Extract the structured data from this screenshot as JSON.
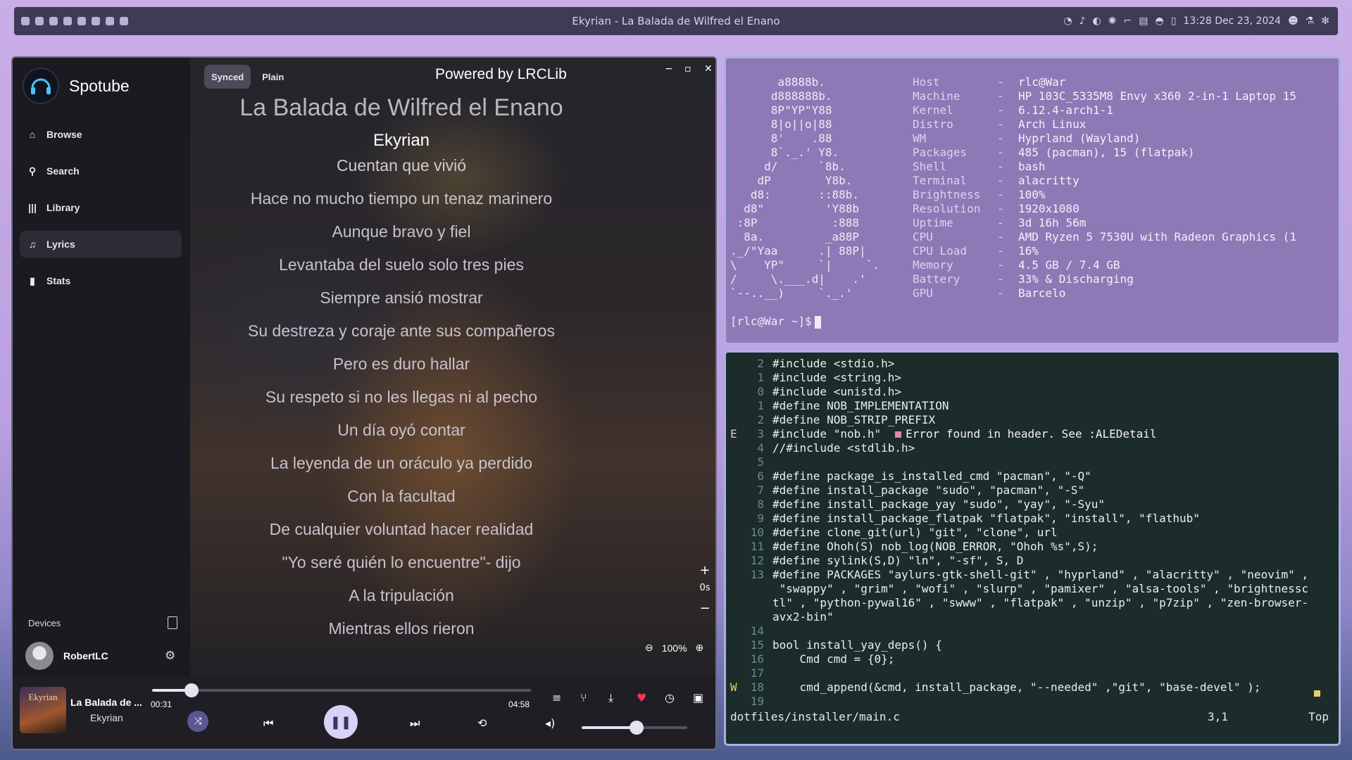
{
  "topbar": {
    "title": "Ekyrian - La Balada de Wilfred el Enano",
    "datetime": "13:28 Dec 23, 2024",
    "left_icons": [
      "app-icon-1",
      "app-icon-2",
      "app-icon-3",
      "app-icon-4",
      "app-icon-5",
      "app-icon-6",
      "app-icon-7",
      "app-icon-8"
    ],
    "right_icons": [
      "wifi-icon",
      "volume-icon",
      "moon-icon",
      "brightness-icon",
      "arrow-icon",
      "keyboard-icon",
      "headphones-icon",
      "clipboard-icon",
      "discord-icon",
      "flask-icon",
      "gear-icon"
    ]
  },
  "spotube": {
    "app_name": "Spotube",
    "nav": [
      {
        "label": "Browse",
        "icon": "home-icon"
      },
      {
        "label": "Search",
        "icon": "search-icon"
      },
      {
        "label": "Library",
        "icon": "library-icon"
      },
      {
        "label": "Lyrics",
        "icon": "music-note-icon",
        "active": true
      },
      {
        "label": "Stats",
        "icon": "bar-chart-icon"
      }
    ],
    "devices_label": "Devices",
    "username": "RobertLC",
    "tabs": {
      "synced": "Synced",
      "plain": "Plain"
    },
    "powered_by": "Powered by LRCLib",
    "song_title": "La Balada de Wilfred el Enano",
    "artist": "Ekyrian",
    "lyrics": [
      "Cuentan que vivió",
      "Hace no mucho tiempo un tenaz marinero",
      "Aunque bravo y fiel",
      "Levantaba del suelo solo tres pies",
      "Siempre ansió mostrar",
      "Su destreza y coraje ante sus compañeros",
      "Pero es duro hallar",
      "Su respeto si no les llegas ni al pecho",
      "Un día oyó contar",
      "La leyenda de un oráculo ya perdido",
      "Con la facultad",
      "De cualquier voluntad hacer realidad",
      "\"Yo seré quién lo encuentre\"- dijo",
      "A la tripulación",
      "Mientras ellos rieron"
    ],
    "time_offset": {
      "plus": "+",
      "value": "0s",
      "minus": "−"
    },
    "zoom": "100%",
    "player": {
      "track_name": "La Balada de ...",
      "track_artist": "Ekyrian",
      "album_text": "Ekyrian",
      "elapsed": "00:31",
      "duration": "04:58",
      "progress": 0.104,
      "volume": 0.52
    }
  },
  "terminal": {
    "ascii": "       a8888b.\n      d888888b.\n      8P\"YP\"Y88\n      8|o||o|88\n      8'    .88\n      8`._.' Y8.\n     d/      `8b.\n    dP        Y8b.\n   d8:       ::88b.\n  d8\"         'Y88b\n :8P           :888\n  8a.         _a88P\n._/\"Yaa      .| 88P|\n\\    YP\"     `|     `.\n/     \\.___.d|    .'\n`--..__)     `._.'",
    "rows": [
      {
        "key": "Host",
        "value": "rlc@War"
      },
      {
        "key": "Machine",
        "value": "HP 103C_5335M8 Envy x360 2-in-1 Laptop 15"
      },
      {
        "key": "Kernel",
        "value": "6.12.4-arch1-1"
      },
      {
        "key": "Distro",
        "value": "Arch Linux"
      },
      {
        "key": "WM",
        "value": "Hyprland (Wayland)"
      },
      {
        "key": "Packages",
        "value": "485 (pacman), 15 (flatpak)"
      },
      {
        "key": "Shell",
        "value": "bash"
      },
      {
        "key": "Terminal",
        "value": "alacritty"
      },
      {
        "key": "Brightness",
        "value": "100%"
      },
      {
        "key": "Resolution",
        "value": "1920x1080"
      },
      {
        "key": "Uptime",
        "value": "3d 16h 56m"
      },
      {
        "key": "CPU",
        "value": "AMD Ryzen 5 7530U with Radeon Graphics (1"
      },
      {
        "key": "CPU Load",
        "value": "16%"
      },
      {
        "key": "Memory",
        "value": "4.5 GB / 7.4 GB"
      },
      {
        "key": "Battery",
        "value": "33% & Discharging"
      },
      {
        "key": "GPU",
        "value": "Barcelo"
      }
    ],
    "separator": "-",
    "prompt": "[rlc@War ~]$"
  },
  "editor": {
    "lines": [
      {
        "sign": "",
        "num": "2",
        "text": "#include <stdio.h>"
      },
      {
        "sign": "",
        "num": "1",
        "text": "#include <string.h>"
      },
      {
        "sign": "",
        "num": "0",
        "text": "#include <unistd.h>"
      },
      {
        "sign": "",
        "num": "1",
        "text": "#define NOB_IMPLEMENTATION"
      },
      {
        "sign": "",
        "num": "2",
        "text": "#define NOB_STRIP_PREFIX"
      },
      {
        "sign": "E",
        "num": "3",
        "text": "#include \"nob.h\"",
        "error": "Error found in header. See :ALEDetail"
      },
      {
        "sign": "",
        "num": "4",
        "text": "//#include <stdlib.h>"
      },
      {
        "sign": "",
        "num": "5",
        "text": ""
      },
      {
        "sign": "",
        "num": "6",
        "text": "#define package_is_installed_cmd \"pacman\", \"-Q\""
      },
      {
        "sign": "",
        "num": "7",
        "text": "#define install_package \"sudo\", \"pacman\", \"-S\""
      },
      {
        "sign": "",
        "num": "8",
        "text": "#define install_package_yay \"sudo\", \"yay\", \"-Syu\""
      },
      {
        "sign": "",
        "num": "9",
        "text": "#define install_package_flatpak \"flatpak\", \"install\", \"flathub\""
      },
      {
        "sign": "",
        "num": "10",
        "text": "#define clone_git(url) \"git\", \"clone\", url"
      },
      {
        "sign": "",
        "num": "11",
        "text": "#define Ohoh(S) nob_log(NOB_ERROR, \"Ohoh %s\",S);"
      },
      {
        "sign": "",
        "num": "12",
        "text": "#define sylink(S,D) \"ln\", \"-sf\", S, D"
      },
      {
        "sign": "",
        "num": "13",
        "text": "#define PACKAGES \"aylurs-gtk-shell-git\" , \"hyprland\" , \"alacritty\" , \"neovim\" ,"
      },
      {
        "sign": "",
        "num": "",
        "text": " \"swappy\" , \"grim\" , \"wofi\" , \"slurp\" , \"pamixer\" , \"alsa-tools\" , \"brightnessc"
      },
      {
        "sign": "",
        "num": "",
        "text": "tl\" , \"python-pywal16\" , \"swww\" , \"flatpak\" , \"unzip\" , \"p7zip\" , \"zen-browser-"
      },
      {
        "sign": "",
        "num": "",
        "text": "avx2-bin\""
      },
      {
        "sign": "",
        "num": "14",
        "text": ""
      },
      {
        "sign": "",
        "num": "15",
        "text": "bool install_yay_deps() {"
      },
      {
        "sign": "",
        "num": "16",
        "text": "    Cmd cmd = {0};"
      },
      {
        "sign": "",
        "num": "17",
        "text": ""
      },
      {
        "sign": "W",
        "num": "18",
        "text": "    cmd_append(&cmd, install_package, \"--needed\" ,\"git\", \"base-devel\" );"
      },
      {
        "sign": "",
        "num": "19",
        "text": ""
      }
    ],
    "status_file": "dotfiles/installer/main.c",
    "status_pos": "3,1",
    "status_scroll": "Top"
  }
}
